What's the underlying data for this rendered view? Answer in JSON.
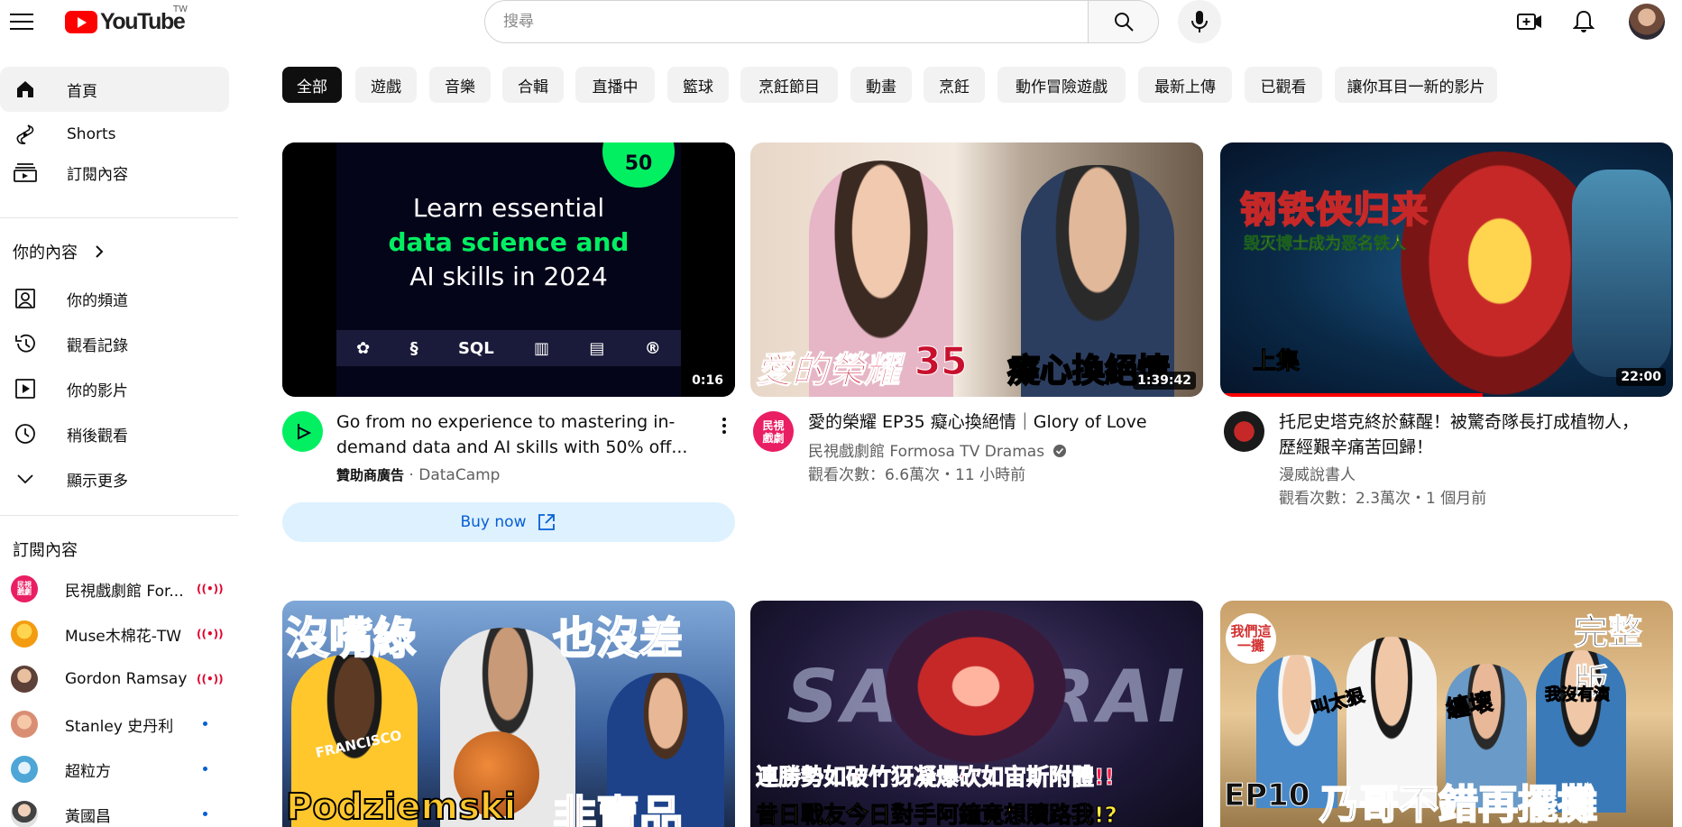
{
  "header": {
    "logo_text": "YouTube",
    "region": "TW",
    "search_placeholder": "搜尋"
  },
  "sidebar": {
    "main": [
      {
        "label": "首頁",
        "icon": "home-icon",
        "active": true
      },
      {
        "label": "Shorts",
        "icon": "shorts-icon"
      },
      {
        "label": "訂閱內容",
        "icon": "subscriptions-icon"
      }
    ],
    "you_heading": "你的內容",
    "you": [
      {
        "label": "你的頻道",
        "icon": "channel-icon"
      },
      {
        "label": "觀看記錄",
        "icon": "history-icon"
      },
      {
        "label": "你的影片",
        "icon": "your-videos-icon"
      },
      {
        "label": "稍後觀看",
        "icon": "watch-later-icon"
      },
      {
        "label": "顯示更多",
        "icon": "chevron-down-icon"
      }
    ],
    "subs_heading": "訂閱內容",
    "subscriptions": [
      {
        "name": "民視戲劇館 For...",
        "status": "live",
        "avatar_text": "民視\n戲劇",
        "color": "#e91e63"
      },
      {
        "name": "Muse木棉花-TW",
        "status": "live",
        "avatar_text": "",
        "color": "#f39c12"
      },
      {
        "name": "Gordon Ramsay",
        "status": "live",
        "avatar_text": "",
        "color": "#8d6e63"
      },
      {
        "name": "Stanley 史丹利",
        "status": "new",
        "avatar_text": "",
        "color": "#d98e73"
      },
      {
        "name": "超粒方",
        "status": "new",
        "avatar_text": "",
        "color": "#4ea6d6"
      },
      {
        "name": "黃國昌",
        "status": "new",
        "avatar_text": "",
        "color": "#bdbdbd"
      }
    ],
    "live_symbol": "((•))"
  },
  "chips": [
    "全部",
    "遊戲",
    "音樂",
    "合輯",
    "直播中",
    "籃球",
    "烹飪節目",
    "動畫",
    "烹飪",
    "動作冒險遊戲",
    "最新上傳",
    "已觀看",
    "讓你耳目一新的影片"
  ],
  "videos": [
    {
      "title": "Go from no experience to mastering in-demand data and AI skills with 50% off...",
      "channel": "DataCamp",
      "sponsor_label": "贊助商廣告",
      "duration": "0:16",
      "buy_label": "Buy now",
      "thumb_lines": [
        "Learn essential",
        "data science and",
        "AI skills in 2024"
      ],
      "thumb_icons": "SQL",
      "badge": "50"
    },
    {
      "title": "愛的榮耀 EP35 癡心換絕情｜Glory of Love",
      "channel": "民視戲劇館 Formosa TV Dramas",
      "verified": true,
      "meta": "觀看次數：6.6萬次・11 小時前",
      "duration": "1:39:42",
      "overlay_left": "愛的榮耀",
      "overlay_num": "35",
      "overlay_right": "癡心換絕情",
      "avatar_text": "民視\n戲劇"
    },
    {
      "title": "托尼史塔克終於蘇醒！被驚奇隊長打成植物人，歷經艱辛痛苦回歸！",
      "channel": "漫威說書人",
      "meta": "觀看次數：2.3萬次・1 個月前",
      "duration": "22:00",
      "overlay_title": "钢铁侠归来",
      "overlay_sub": "毁灭博士成为恶名铁人",
      "overlay_tag": "上集",
      "progress": 0.58
    }
  ],
  "row2": [
    {
      "overlay_top_left": "沒嘴綠",
      "overlay_top_right": "也沒差",
      "overlay_bottom": "Podziemski",
      "overlay_bottom2": "非賣品",
      "jersey": "FRANCISCO"
    },
    {
      "overlay_word": "SAMURAI",
      "overlay_bottom": "連勝勢如破竹犽凝爆砍如宙斯附體!!",
      "overlay_bottom2": "昔日戰友今日對手阿鐘竟想贖路我!?"
    },
    {
      "overlay_top": "完整版",
      "overlay_left": "我們這一攤",
      "overlay_bottom": "EP10",
      "overlay_bottom2": "乃哥不錯再擺攤",
      "overlay_words": [
        "叫太狠",
        "纏壞",
        "我沒有演"
      ]
    }
  ]
}
